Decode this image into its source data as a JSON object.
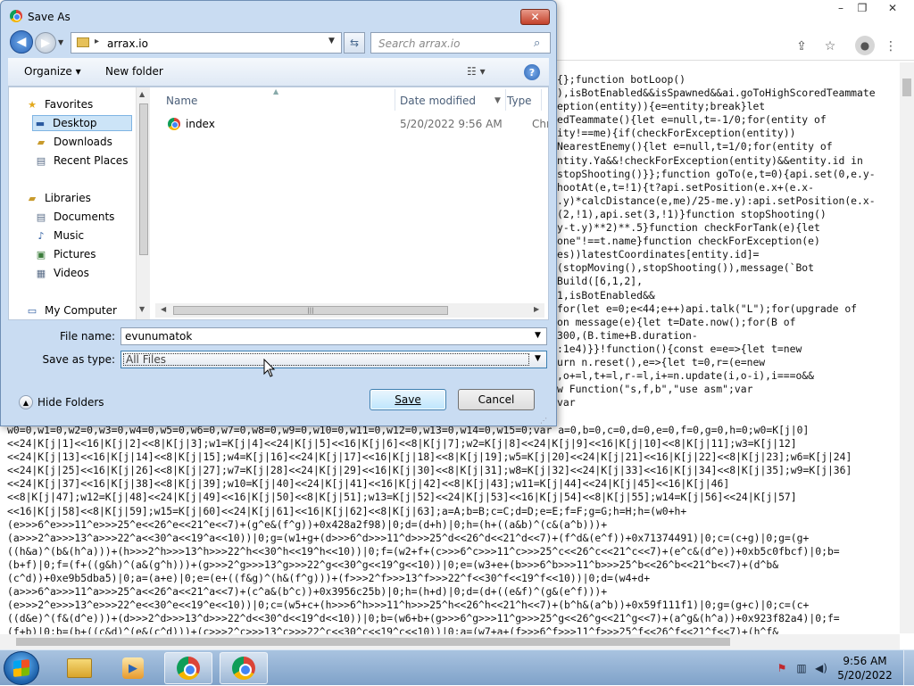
{
  "browser": {
    "window_controls": [
      "–",
      "❐",
      "✕"
    ],
    "toolbar_icons": [
      "share-icon",
      "star-icon"
    ],
    "code_right_lines": [
      "{};function botLoop()",
      "),isBotEnabled&&isSpawned&&ai.goToHighScoredTeammate",
      "",
      "eption(entity)){e=entity;break}let",
      "edTeammate(){let e=null,t=-1/0;for(entity of",
      "ity!==me){if(checkForException(entity))",
      "NearestEnemy(){let e=null,t=1/0;for(entity of",
      "ntity.Ya&&!checkForException(entity)&&entity.id in",
      "stopShooting()}};function goTo(e,t=0){api.set(0,e.y-",
      "hootAt(e,t=!1){t?api.setPosition(e.x+(e.x-",
      ".y)*calcDistance(e,me)/25-me.y):api.setPosition(e.x-",
      "(2,!1),api.set(3,!1)}function stopShooting()",
      "y-t.y)**2)**.5}function checkForTank(e){let",
      "one\"!==t.name}function checkForException(e)",
      "es))latestCoordinates[entity.id]=",
      "(stopMoving(),stopShooting()),message(`Bot",
      "Build([6,1,2],",
      "1,isBotEnabled&&",
      "for(let e=0;e<44;e++)api.talk(\"L\");for(upgrade of",
      "on message(e){let t=Date.now();for(B of",
      "300,(B.time+B.duration-",
      ":1e4)}}!function(){const e=e=>{let t=new",
      "urn n.reset(),e=>{let t=0,r=(e=new",
      ",o+=l,t+=l,r-=l,i+=n.update(i,o-i),i===o&&",
      "w Function(\"s,f,b\",\"use asm\";var",
      "var"
    ],
    "code_bottom_lines": [
      "w0=0,w1=0,w2=0,w3=0,w4=0,w5=0,w6=0,w7=0,w8=0,w9=0,w10=0,w11=0,w12=0,w13=0,w14=0,w15=0;var a=0,b=0,c=0,d=0,e=0,f=0,g=0,h=0;w0=K[j|0]",
      "<<24|K[j|1]<<16|K[j|2]<<8|K[j|3];w1=K[j|4]<<24|K[j|5]<<16|K[j|6]<<8|K[j|7];w2=K[j|8]<<24|K[j|9]<<16|K[j|10]<<8|K[j|11];w3=K[j|12]",
      "<<24|K[j|13]<<16|K[j|14]<<8|K[j|15];w4=K[j|16]<<24|K[j|17]<<16|K[j|18]<<8|K[j|19];w5=K[j|20]<<24|K[j|21]<<16|K[j|22]<<8|K[j|23];w6=K[j|24]",
      "<<24|K[j|25]<<16|K[j|26]<<8|K[j|27];w7=K[j|28]<<24|K[j|29]<<16|K[j|30]<<8|K[j|31];w8=K[j|32]<<24|K[j|33]<<16|K[j|34]<<8|K[j|35];w9=K[j|36]",
      "<<24|K[j|37]<<16|K[j|38]<<8|K[j|39];w10=K[j|40]<<24|K[j|41]<<16|K[j|42]<<8|K[j|43];w11=K[j|44]<<24|K[j|45]<<16|K[j|46]",
      "<<8|K[j|47];w12=K[j|48]<<24|K[j|49]<<16|K[j|50]<<8|K[j|51];w13=K[j|52]<<24|K[j|53]<<16|K[j|54]<<8|K[j|55];w14=K[j|56]<<24|K[j|57]",
      "<<16|K[j|58]<<8|K[j|59];w15=K[j|60]<<24|K[j|61]<<16|K[j|62]<<8|K[j|63];a=A;b=B;c=C;d=D;e=E;f=F;g=G;h=H;h=(w0+h+",
      "(e>>>6^e>>>11^e>>>25^e<<26^e<<21^e<<7)+(g^e&(f^g))+0x428a2f98)|0;d=(d+h)|0;h=(h+((a&b)^(c&(a^b)))+",
      "(a>>>2^a>>>13^a>>>22^a<<30^a<<19^a<<10))|0;g=(w1+g+(d>>>6^d>>>11^d>>>25^d<<26^d<<21^d<<7)+(f^d&(e^f))+0x71374491)|0;c=(c+g)|0;g=(g+",
      "((h&a)^(b&(h^a)))+(h>>>2^h>>>13^h>>>22^h<<30^h<<19^h<<10))|0;f=(w2+f+(c>>>6^c>>>11^c>>>25^c<<26^c<<21^c<<7)+(e^c&(d^e))+0xb5c0fbcf)|0;b=",
      "(b+f)|0;f=(f+((g&h)^(a&(g^h)))+(g>>>2^g>>>13^g>>>22^g<<30^g<<19^g<<10))|0;e=(w3+e+(b>>>6^b>>>11^b>>>25^b<<26^b<<21^b<<7)+(d^b&",
      "(c^d))+0xe9b5dba5)|0;a=(a+e)|0;e=(e+((f&g)^(h&(f^g)))+(f>>>2^f>>>13^f>>>22^f<<30^f<<19^f<<10))|0;d=(w4+d+",
      "(a>>>6^a>>>11^a>>>25^a<<26^a<<21^a<<7)+(c^a&(b^c))+0x3956c25b)|0;h=(h+d)|0;d=(d+((e&f)^(g&(e^f)))+",
      "(e>>>2^e>>>13^e>>>22^e<<30^e<<19^e<<10))|0;c=(w5+c+(h>>>6^h>>>11^h>>>25^h<<26^h<<21^h<<7)+(b^h&(a^b))+0x59f111f1)|0;g=(g+c)|0;c=(c+",
      "((d&e)^(f&(d^e)))+(d>>>2^d>>>13^d>>>22^d<<30^d<<19^d<<10))|0;b=(w6+b+(g>>>6^g>>>11^g>>>25^g<<26^g<<21^g<<7)+(a^g&(h^a))+0x923f82a4)|0;f=",
      "(f+b)|0;b=(b+((c&d)^(e&(c^d)))+(c>>>2^c>>>13^c>>>22^c<<30^c<<19^c<<10))|0;a=(w7+a+(f>>>6^f>>>11^f>>>25^f<<26^f<<21^f<<7)+(h^f&"
    ]
  },
  "dialog": {
    "title": "Save As",
    "close_label": "✕",
    "address": {
      "current_folder": "arrax.io"
    },
    "search": {
      "placeholder": "Search arrax.io"
    },
    "commands": {
      "organize": "Organize ▾",
      "new_folder": "New folder"
    },
    "nav_pane": {
      "favorites_label": "Favorites",
      "items": [
        {
          "label": "Desktop",
          "icon": "desktop-icon"
        },
        {
          "label": "Downloads",
          "icon": "downloads-icon"
        },
        {
          "label": "Recent Places",
          "icon": "recent-places-icon"
        }
      ],
      "libraries_label": "Libraries",
      "library_items": [
        {
          "label": "Documents",
          "icon": "documents-icon"
        },
        {
          "label": "Music",
          "icon": "music-icon"
        },
        {
          "label": "Pictures",
          "icon": "pictures-icon"
        },
        {
          "label": "Videos",
          "icon": "videos-icon"
        }
      ],
      "computer_label": "My Computer"
    },
    "file_list": {
      "columns": [
        "Name",
        "Date modified",
        "Type"
      ],
      "files": [
        {
          "name": "index",
          "date_modified": "5/20/2022 9:56 AM",
          "type": "Chrome H"
        }
      ]
    },
    "file_name": {
      "label": "File name:",
      "value": "evunumatok"
    },
    "save_as_type": {
      "label": "Save as type:",
      "value": "All Files"
    },
    "hide_folders_label": "Hide Folders",
    "save_label": "Save",
    "cancel_label": "Cancel"
  },
  "taskbar": {
    "clock_time": "9:56 AM",
    "clock_date": "5/20/2022"
  }
}
